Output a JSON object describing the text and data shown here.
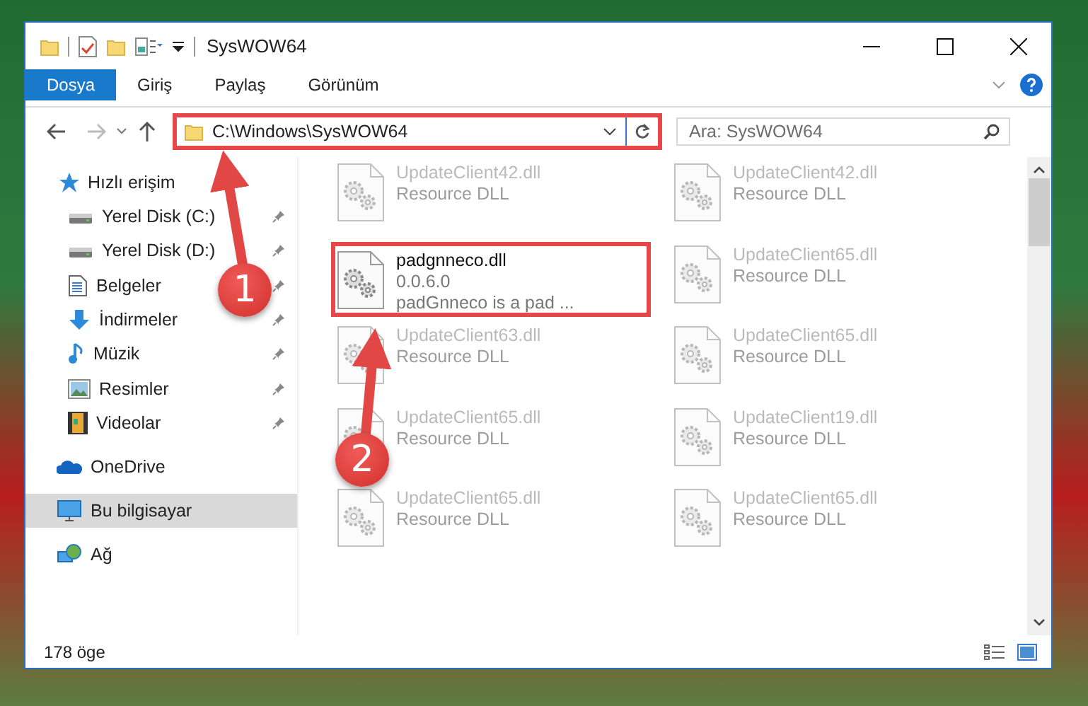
{
  "window": {
    "title": "SysWOW64"
  },
  "ribbon_tabs": [
    {
      "label": "Dosya",
      "selected": true
    },
    {
      "label": "Giriş",
      "selected": false
    },
    {
      "label": "Paylaş",
      "selected": false
    },
    {
      "label": "Görünüm",
      "selected": false
    }
  ],
  "address_bar": {
    "path": "C:\\Windows\\SysWOW64",
    "highlighted": true
  },
  "search": {
    "placeholder": "Ara: SysWOW64"
  },
  "sidebar": {
    "items": [
      {
        "label": "Hızlı erişim",
        "kind": "star",
        "selected": false,
        "children": [
          {
            "label": "Yerel Disk (C:)",
            "kind": "drive",
            "pinned": true
          },
          {
            "label": "Yerel Disk (D:)",
            "kind": "drive",
            "pinned": true
          },
          {
            "label": "Belgeler",
            "kind": "document",
            "pinned": true
          },
          {
            "label": "İndirmeler",
            "kind": "download",
            "pinned": true
          },
          {
            "label": "Müzik",
            "kind": "music",
            "pinned": true
          },
          {
            "label": "Resimler",
            "kind": "picture",
            "pinned": true
          },
          {
            "label": "Videolar",
            "kind": "video",
            "pinned": true
          }
        ]
      },
      {
        "label": "OneDrive",
        "kind": "cloud",
        "selected": false
      },
      {
        "label": "Bu bilgisayar",
        "kind": "computer",
        "selected": true
      },
      {
        "label": "Ağ",
        "kind": "network",
        "selected": false
      }
    ]
  },
  "files": [
    {
      "name": "UpdateClient42.dll",
      "details": [
        "Resource DLL"
      ],
      "blurred": true,
      "highlighted": false
    },
    {
      "name": "UpdateClient42.dll",
      "details": [
        "Resource DLL"
      ],
      "blurred": true,
      "highlighted": false
    },
    {
      "name": "padgnneco.dll",
      "details": [
        "0.0.6.0",
        "padGnneco is a pad ..."
      ],
      "blurred": false,
      "highlighted": true
    },
    {
      "name": "UpdateClient65.dll",
      "details": [
        "Resource DLL"
      ],
      "blurred": true,
      "highlighted": false
    },
    {
      "name": "UpdateClient63.dll",
      "details": [
        "Resource DLL"
      ],
      "blurred": true,
      "highlighted": false
    },
    {
      "name": "UpdateClient65.dll",
      "details": [
        "Resource DLL"
      ],
      "blurred": true,
      "highlighted": false
    },
    {
      "name": "UpdateClient65.dll",
      "details": [
        "Resource DLL"
      ],
      "blurred": true,
      "highlighted": false
    },
    {
      "name": "UpdateClient19.dll",
      "details": [
        "Resource DLL"
      ],
      "blurred": true,
      "highlighted": false
    },
    {
      "name": "UpdateClient65.dll",
      "details": [
        "Resource DLL"
      ],
      "blurred": true,
      "highlighted": false
    },
    {
      "name": "UpdateClient65.dll",
      "details": [
        "Resource DLL"
      ],
      "blurred": true,
      "highlighted": false
    }
  ],
  "status_bar": {
    "item_count": "178 öge"
  },
  "annotations": [
    {
      "label": "1"
    },
    {
      "label": "2"
    }
  ]
}
